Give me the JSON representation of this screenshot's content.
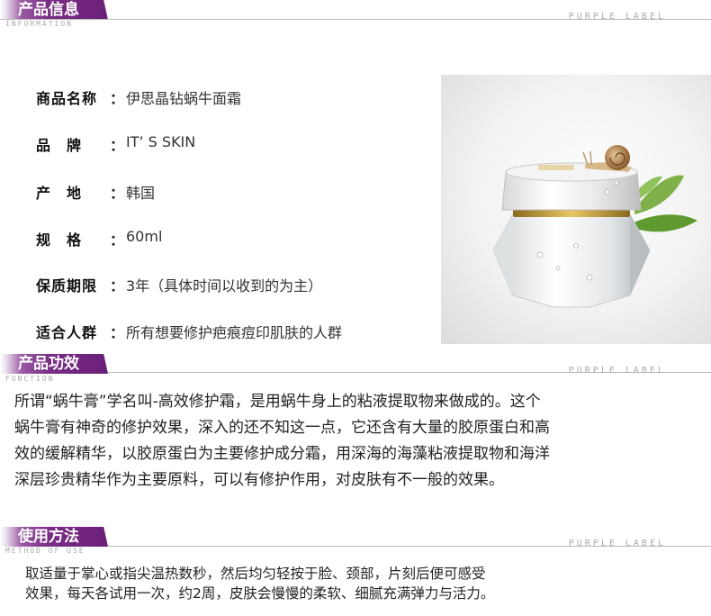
{
  "sections": {
    "info": {
      "title": "产品信息",
      "subtitle": "INFORMATION",
      "brand": "PURPLE LABEL"
    },
    "function": {
      "title": "产品功效",
      "subtitle": "FUNCTION",
      "brand": "PURPLE LABEL"
    },
    "usage": {
      "title": "使用方法",
      "subtitle": "METHOD OF USE",
      "brand": "PURPLE LABEL"
    }
  },
  "info_rows": [
    {
      "label": "商品名称",
      "value": "伊思晶钻蜗牛面霜"
    },
    {
      "label": "品　牌",
      "value": "IT’ S SKIN"
    },
    {
      "label": "产　地",
      "value": "韩国"
    },
    {
      "label": "规　格",
      "value": "60ml"
    },
    {
      "label": "保质期限",
      "value": "3年（具体时间以收到的为主）"
    },
    {
      "label": "适合人群",
      "value": "所有想要修护疤痕痘印肌肤的人群"
    }
  ],
  "function_text": [
    "所谓“蜗牛膏”学名叫-高效修护霜，是用蜗牛身上的粘液提取物来做成的。这个",
    "蜗牛膏有神奇的修护效果，深入的还不知这一点，它还含有大量的胶原蛋白和高",
    "效的缓解精华，以胶原蛋白为主要修护成分霜，用深海的海藻粘液提取物和海洋",
    "深层珍贵精华作为主要原料，可以有修护作用，对皮肤有不一般的效果。"
  ],
  "usage_text": [
    "取适量于掌心或指尖温热数秒，然后均匀轻按于脸、颈部，片刻后便可感受",
    "效果，每天各试用一次，约2周，皮肤会慢慢的柔软、细腻充满弹力与活力。"
  ],
  "colors": {
    "accent": "#6a1f78"
  }
}
